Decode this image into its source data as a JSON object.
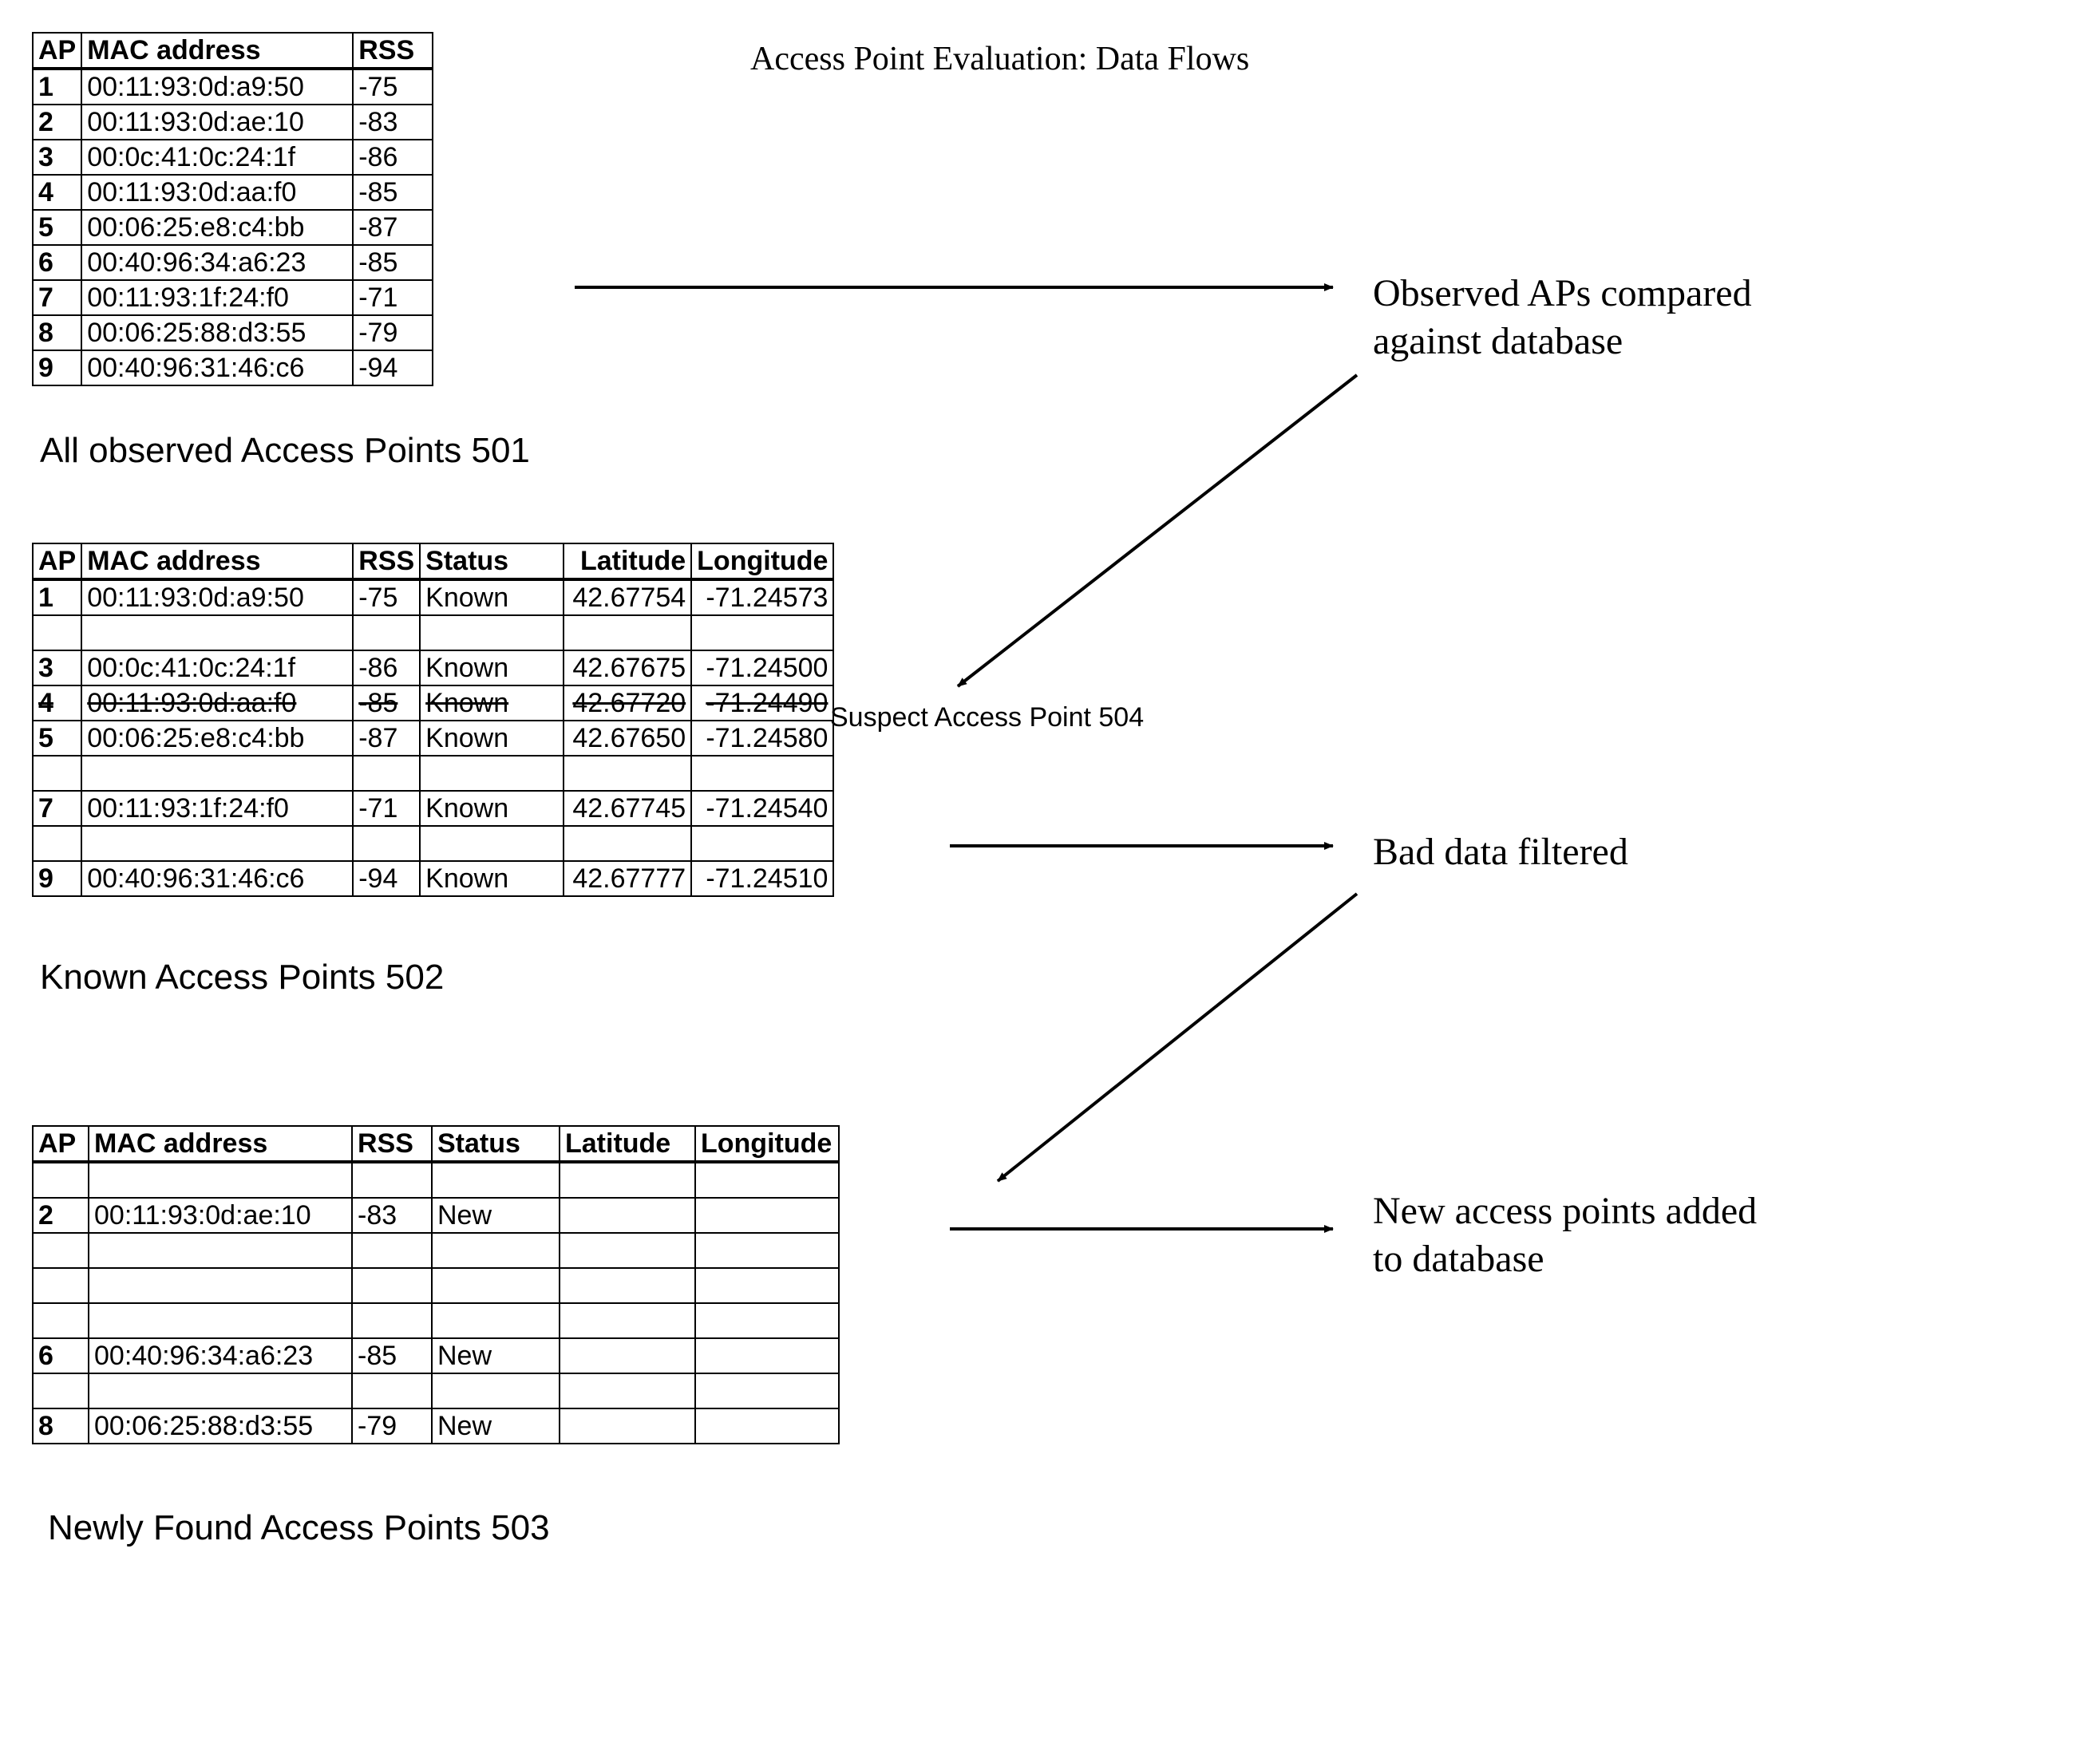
{
  "title": "Access Point Evaluation: Data Flows",
  "labels": {
    "observed_caption": "All observed Access Points 501",
    "known_caption": "Known Access Points  502",
    "new_caption": "Newly Found Access Points 503",
    "suspect": "Suspect Access Point 504",
    "side1a": "Observed APs compared",
    "side1b": "against database",
    "side2": "Bad data filtered",
    "side3a": "New access points added",
    "side3b": "to database"
  },
  "headers": {
    "ap": "AP",
    "mac": "MAC address",
    "rss": "RSS",
    "status": "Status",
    "lat": "Latitude",
    "lon": "Longitude"
  },
  "observed": {
    "rows": [
      {
        "ap": "1",
        "mac": "00:11:93:0d:a9:50",
        "rss": "-75"
      },
      {
        "ap": "2",
        "mac": "00:11:93:0d:ae:10",
        "rss": "-83"
      },
      {
        "ap": "3",
        "mac": "00:0c:41:0c:24:1f",
        "rss": "-86"
      },
      {
        "ap": "4",
        "mac": "00:11:93:0d:aa:f0",
        "rss": "-85"
      },
      {
        "ap": "5",
        "mac": "00:06:25:e8:c4:bb",
        "rss": "-87"
      },
      {
        "ap": "6",
        "mac": "00:40:96:34:a6:23",
        "rss": "-85"
      },
      {
        "ap": "7",
        "mac": "00:11:93:1f:24:f0",
        "rss": "-71"
      },
      {
        "ap": "8",
        "mac": "00:06:25:88:d3:55",
        "rss": "-79"
      },
      {
        "ap": "9",
        "mac": "00:40:96:31:46:c6",
        "rss": "-94"
      }
    ]
  },
  "known": {
    "rows": [
      {
        "ap": "1",
        "mac": "00:11:93:0d:a9:50",
        "rss": "-75",
        "status": "Known",
        "lat": "42.67754",
        "lon": "-71.24573",
        "strike": false
      },
      {
        "ap": "",
        "mac": "",
        "rss": "",
        "status": "",
        "lat": "",
        "lon": "",
        "strike": false
      },
      {
        "ap": "3",
        "mac": "00:0c:41:0c:24:1f",
        "rss": "-86",
        "status": "Known",
        "lat": "42.67675",
        "lon": "-71.24500",
        "strike": false
      },
      {
        "ap": "4",
        "mac": "00:11:93:0d:aa:f0",
        "rss": "-85",
        "status": "Known",
        "lat": "42.67720",
        "lon": "-71.24490",
        "strike": true
      },
      {
        "ap": "5",
        "mac": "00:06:25:e8:c4:bb",
        "rss": "-87",
        "status": "Known",
        "lat": "42.67650",
        "lon": "-71.24580",
        "strike": false
      },
      {
        "ap": "",
        "mac": "",
        "rss": "",
        "status": "",
        "lat": "",
        "lon": "",
        "strike": false
      },
      {
        "ap": "7",
        "mac": "00:11:93:1f:24:f0",
        "rss": "-71",
        "status": "Known",
        "lat": "42.67745",
        "lon": "-71.24540",
        "strike": false
      },
      {
        "ap": "",
        "mac": "",
        "rss": "",
        "status": "",
        "lat": "",
        "lon": "",
        "strike": false
      },
      {
        "ap": "9",
        "mac": "00:40:96:31:46:c6",
        "rss": "-94",
        "status": "Known",
        "lat": "42.67777",
        "lon": "-71.24510",
        "strike": false
      }
    ]
  },
  "newfound": {
    "rows": [
      {
        "ap": "",
        "mac": "",
        "rss": "",
        "status": "",
        "lat": "",
        "lon": ""
      },
      {
        "ap": "2",
        "mac": "00:11:93:0d:ae:10",
        "rss": "-83",
        "status": "New",
        "lat": "",
        "lon": ""
      },
      {
        "ap": "",
        "mac": "",
        "rss": "",
        "status": "",
        "lat": "",
        "lon": ""
      },
      {
        "ap": "",
        "mac": "",
        "rss": "",
        "status": "",
        "lat": "",
        "lon": ""
      },
      {
        "ap": "",
        "mac": "",
        "rss": "",
        "status": "",
        "lat": "",
        "lon": ""
      },
      {
        "ap": "6",
        "mac": "00:40:96:34:a6:23",
        "rss": "-85",
        "status": "New",
        "lat": "",
        "lon": ""
      },
      {
        "ap": "",
        "mac": "",
        "rss": "",
        "status": "",
        "lat": "",
        "lon": ""
      },
      {
        "ap": "8",
        "mac": "00:06:25:88:d3:55",
        "rss": "-79",
        "status": "New",
        "lat": "",
        "lon": ""
      }
    ]
  }
}
